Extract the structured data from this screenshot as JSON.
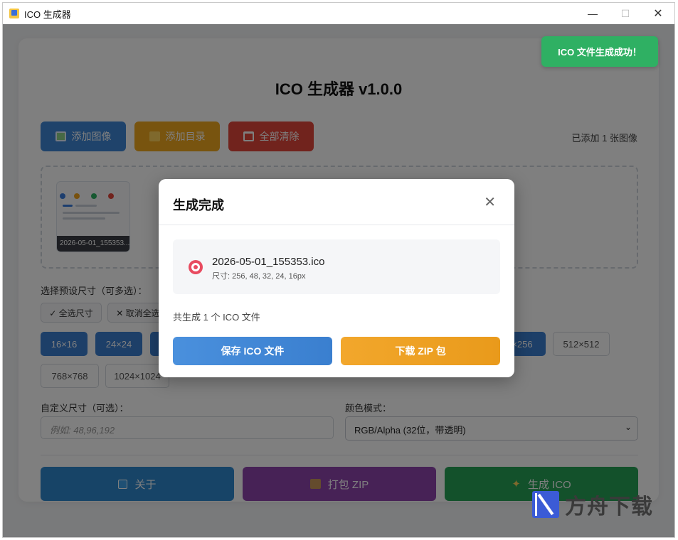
{
  "window": {
    "title": "ICO 生成器",
    "controls": {
      "minimize": "—",
      "maximize": "☐",
      "close": "✕"
    }
  },
  "app": {
    "title": "ICO 生成器 v1.0.0",
    "toolbar": {
      "add_image": "添加图像",
      "add_dir": "添加目录",
      "clear_all": "全部清除",
      "added_count": "已添加 1 张图像"
    },
    "images": [
      {
        "name": "2026-05-01_155353...",
        "thumbnail": "screenshot"
      }
    ],
    "preset_label": "选择预设尺寸（可多选）：",
    "select_all": "✓ 全选尺寸",
    "cancel_all": "✕ 取消全选",
    "sizes": [
      {
        "label": "16×16",
        "selected": true
      },
      {
        "label": "24×24",
        "selected": true
      },
      {
        "label": "×256",
        "selected": true
      },
      {
        "label": "512×512",
        "selected": false
      },
      {
        "label": "768×768",
        "selected": false
      },
      {
        "label": "1024×1024",
        "selected": false
      }
    ],
    "custom_label": "自定义尺寸（可选）：",
    "custom_placeholder": "例如: 48,96,192",
    "color_label": "颜色模式：",
    "color_value": "RGB/Alpha (32位，带透明)",
    "actions": {
      "about": "关于",
      "zip": "打包 ZIP",
      "generate": "生成 ICO"
    }
  },
  "toast": {
    "text": "ICO 文件生成成功！",
    "color": "#2fb063"
  },
  "modal": {
    "title": "生成完成",
    "close": "✕",
    "file_name": "2026-05-01_155353.ico",
    "file_sizes": "尺寸: 256, 48, 32, 24, 16px",
    "total": "共生成 1 个 ICO 文件",
    "save_button": "保存 ICO 文件",
    "zip_button": "下载 ZIP 包"
  },
  "watermark": {
    "text": "方舟下载"
  }
}
